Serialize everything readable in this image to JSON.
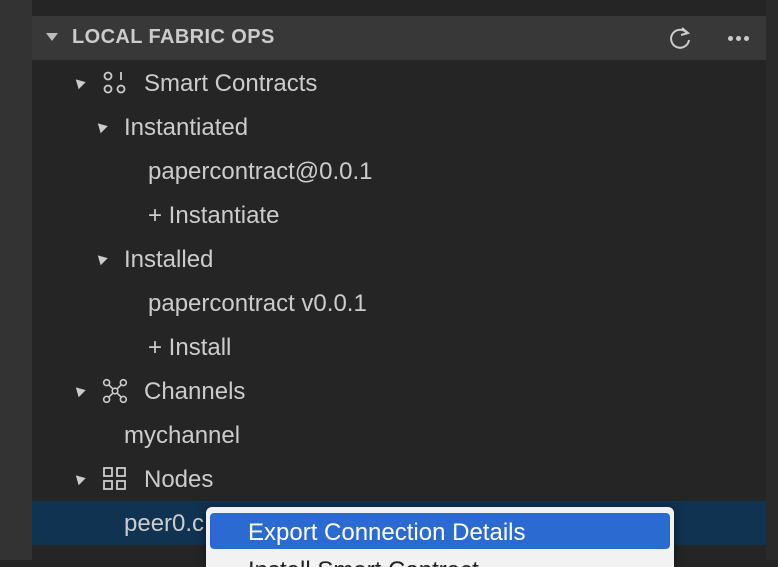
{
  "section": {
    "title": "LOCAL FABRIC OPS",
    "refresh_icon": "refresh-icon",
    "more_icon": "more-actions-icon"
  },
  "tree": {
    "smart_contracts": {
      "label": "Smart Contracts",
      "icon": "smart-contracts-icon",
      "instantiated": {
        "label": "Instantiated",
        "items": [
          "papercontract@0.0.1",
          "+ Instantiate"
        ]
      },
      "installed": {
        "label": "Installed",
        "items": [
          "papercontract v0.0.1",
          "+ Install"
        ]
      }
    },
    "channels": {
      "label": "Channels",
      "icon": "channels-icon",
      "items": [
        "mychannel"
      ]
    },
    "nodes": {
      "label": "Nodes",
      "icon": "nodes-icon",
      "items": [
        "peer0.c"
      ]
    }
  },
  "context_menu": {
    "items": [
      "Export Connection Details",
      "Install Smart Contract"
    ]
  },
  "colors": {
    "background": "#252526",
    "header": "#383838",
    "selection": "#0f3351",
    "menu_highlight": "#2b6bd1"
  }
}
